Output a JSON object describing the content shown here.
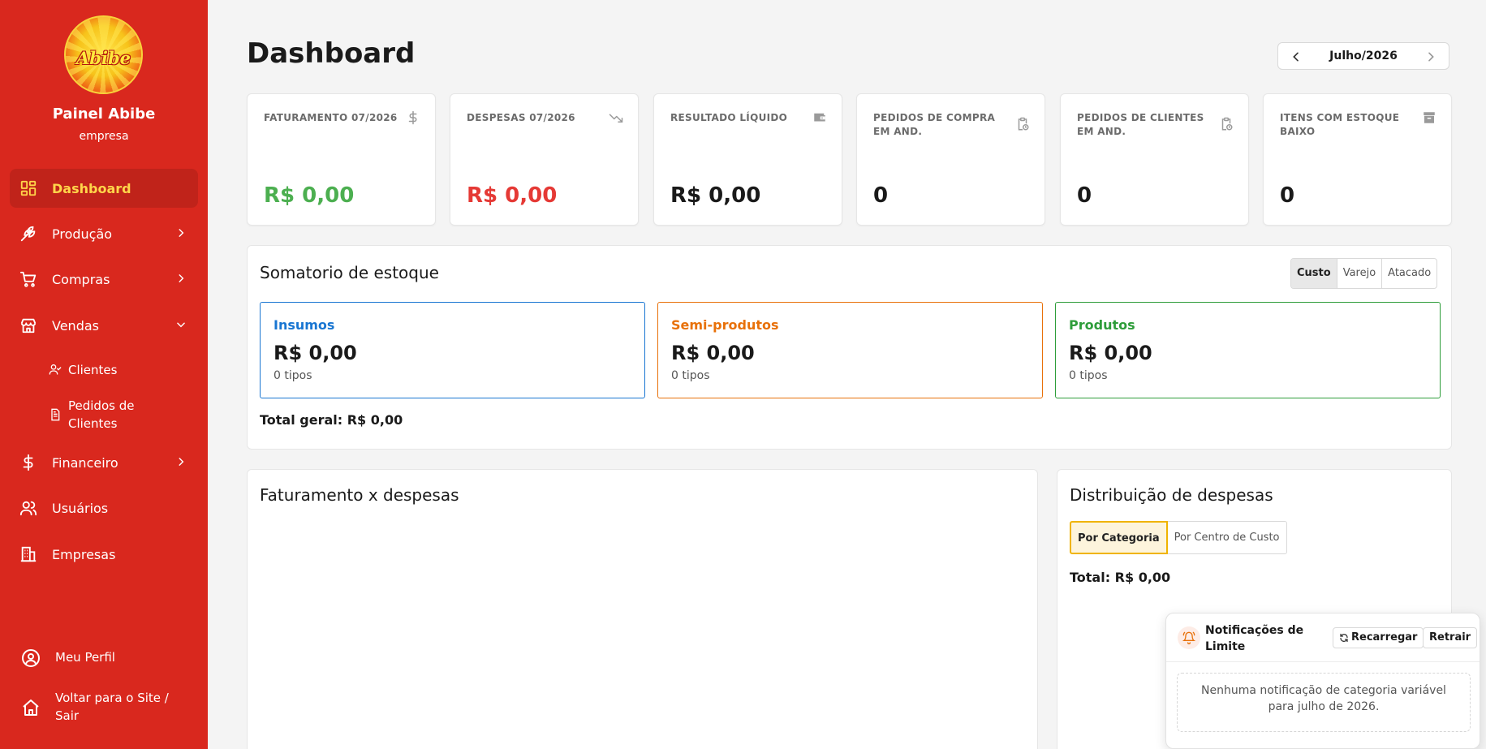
{
  "sidebar": {
    "brand_title": "Painel Abibe",
    "brand_subtitle": "empresa",
    "logo_text": "Abibe",
    "items": [
      {
        "label": "Dashboard",
        "icon": "dashboard-icon",
        "active": true
      },
      {
        "label": "Produção",
        "icon": "wheat-icon"
      },
      {
        "label": "Compras",
        "icon": "cart-icon"
      },
      {
        "label": "Vendas",
        "icon": "store-icon",
        "expanded": true
      },
      {
        "label": "Financeiro",
        "icon": "dollar-icon"
      },
      {
        "label": "Usuários",
        "icon": "users-icon"
      },
      {
        "label": "Empresas",
        "icon": "building-icon"
      }
    ],
    "vendas_sub": [
      {
        "label": "Clientes",
        "icon": "user-check-icon"
      },
      {
        "label": "Pedidos de Clientes",
        "icon": "file-icon"
      }
    ],
    "footer": [
      {
        "label": "Meu Perfil",
        "icon": "user-circle-icon"
      },
      {
        "label": "Voltar para o Site / Sair",
        "icon": "home-icon"
      }
    ],
    "colors": {
      "background": "#d9281e",
      "active_text": "#ffd54a"
    }
  },
  "header": {
    "title": "Dashboard",
    "month": "Julho/2026"
  },
  "stats": [
    {
      "title": "FATURAMENTO 07/2026",
      "value": "R$ 0,00",
      "color": "#4caf50",
      "icon": "dollar-icon"
    },
    {
      "title": "DESPESAS 07/2026",
      "value": "R$ 0,00",
      "color": "#e53935",
      "icon": "trending-down-icon"
    },
    {
      "title": "RESULTADO LÍQUIDO",
      "value": "R$ 0,00",
      "color": "#1a1a1a",
      "icon": "wallet-icon"
    },
    {
      "title": "PEDIDOS DE COMPRA EM AND.",
      "value": "0",
      "color": "#1a1a1a",
      "icon": "clipboard-clock-icon"
    },
    {
      "title": "PEDIDOS DE CLIENTES EM AND.",
      "value": "0",
      "color": "#1a1a1a",
      "icon": "clipboard-clock-icon"
    },
    {
      "title": "ITENS COM ESTOQUE BAIXO",
      "value": "0",
      "color": "#1a1a1a",
      "icon": "archive-icon"
    }
  ],
  "stock": {
    "title": "Somatorio de estoque",
    "modes": [
      "Custo",
      "Varejo",
      "Atacado"
    ],
    "selected_mode": "Custo",
    "boxes": [
      {
        "name": "Insumos",
        "value": "R$ 0,00",
        "sub": "0 tipos",
        "color": "#1976d2"
      },
      {
        "name": "Semi-produtos",
        "value": "R$ 0,00",
        "sub": "0 tipos",
        "color": "#e8710a"
      },
      {
        "name": "Produtos",
        "value": "R$ 0,00",
        "sub": "0 tipos",
        "color": "#2e9d3a"
      }
    ],
    "total": "Total geral: R$ 0,00"
  },
  "revenue_chart": {
    "title": "Faturamento x despesas"
  },
  "expense_dist": {
    "title": "Distribuição de despesas",
    "tabs": [
      "Por Categoria",
      "Por Centro de Custo"
    ],
    "selected_tab": "Por Categoria",
    "total": "Total: R$ 0,00"
  },
  "notifications": {
    "title": "Notificações de Limite",
    "reload_label": "Recarregar",
    "collapse_label": "Retrair",
    "empty_message": "Nenhuma notificação de categoria variável para julho de 2026."
  }
}
